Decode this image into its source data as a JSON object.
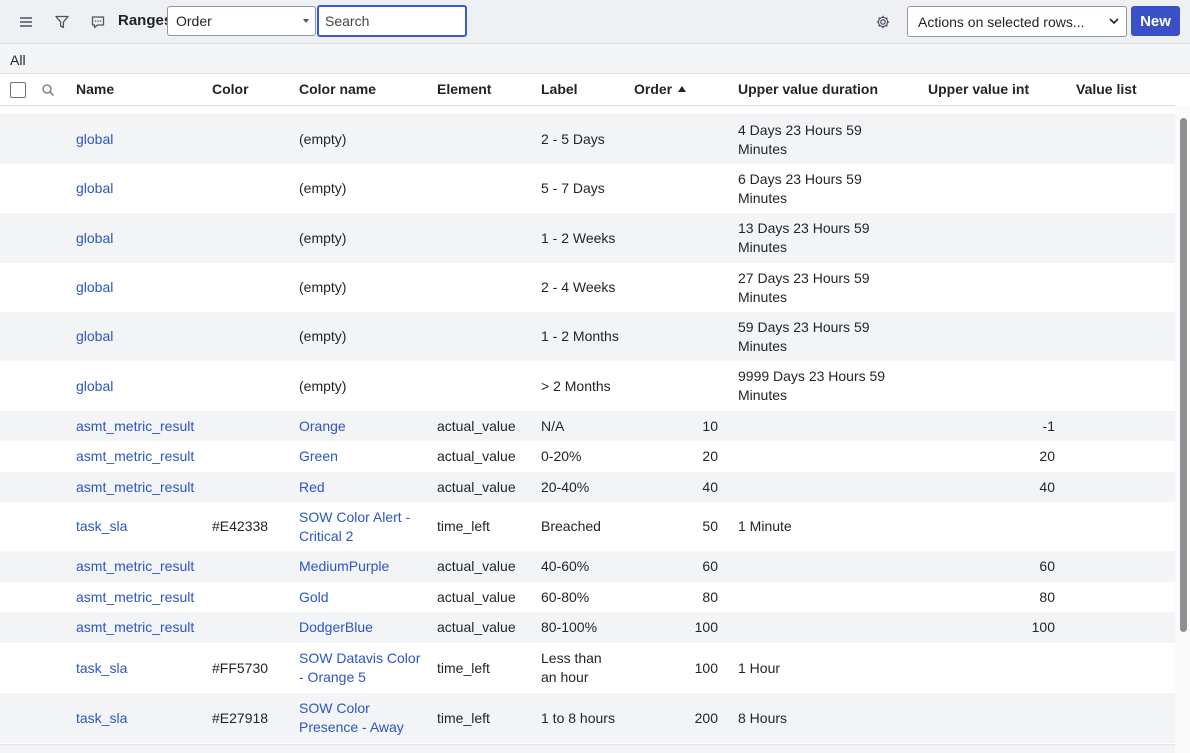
{
  "toolbar": {
    "list_title": "Ranges",
    "field_select": "Order",
    "search_placeholder": "Search",
    "actions_select": "Actions on selected rows...",
    "new_label": "New"
  },
  "breadcrumb": "All",
  "columns": {
    "name": "Name",
    "color": "Color",
    "color_name": "Color name",
    "element": "Element",
    "label": "Label",
    "order": "Order",
    "upper_duration": "Upper value duration",
    "upper_int": "Upper value int",
    "value_list": "Value list"
  },
  "rows": [
    {
      "name": "global",
      "color": "",
      "color_name": "(empty)",
      "element": "",
      "label": "2 - 5 Days",
      "order": "",
      "upper_duration": "4 Days 23 Hours 59 Minutes",
      "upper_int": "",
      "value_list": ""
    },
    {
      "name": "global",
      "color": "",
      "color_name": "(empty)",
      "element": "",
      "label": "5 - 7 Days",
      "order": "",
      "upper_duration": "6 Days 23 Hours 59 Minutes",
      "upper_int": "",
      "value_list": ""
    },
    {
      "name": "global",
      "color": "",
      "color_name": "(empty)",
      "element": "",
      "label": "1 - 2 Weeks",
      "order": "",
      "upper_duration": "13 Days 23 Hours 59 Minutes",
      "upper_int": "",
      "value_list": ""
    },
    {
      "name": "global",
      "color": "",
      "color_name": "(empty)",
      "element": "",
      "label": "2 - 4 Weeks",
      "order": "",
      "upper_duration": "27 Days 23 Hours 59 Minutes",
      "upper_int": "",
      "value_list": ""
    },
    {
      "name": "global",
      "color": "",
      "color_name": "(empty)",
      "element": "",
      "label": "1 - 2 Months",
      "order": "",
      "upper_duration": "59 Days 23 Hours 59 Minutes",
      "upper_int": "",
      "value_list": ""
    },
    {
      "name": "global",
      "color": "",
      "color_name": "(empty)",
      "element": "",
      "label": "> 2 Months",
      "order": "",
      "upper_duration": "9999 Days 23 Hours 59 Minutes",
      "upper_int": "",
      "value_list": ""
    },
    {
      "name": "asmt_metric_result",
      "color": "",
      "color_name": "Orange",
      "element": "actual_value",
      "label": "N/A",
      "order": "10",
      "upper_duration": "",
      "upper_int": "-1",
      "value_list": ""
    },
    {
      "name": "asmt_metric_result",
      "color": "",
      "color_name": "Green",
      "element": "actual_value",
      "label": "0-20%",
      "order": "20",
      "upper_duration": "",
      "upper_int": "20",
      "value_list": ""
    },
    {
      "name": "asmt_metric_result",
      "color": "",
      "color_name": "Red",
      "element": "actual_value",
      "label": "20-40%",
      "order": "40",
      "upper_duration": "",
      "upper_int": "40",
      "value_list": ""
    },
    {
      "name": "task_sla",
      "color": "#E42338",
      "color_name": "SOW Color Alert - Critical 2",
      "element": "time_left",
      "label": "Breached",
      "order": "50",
      "upper_duration": "1 Minute",
      "upper_int": "",
      "value_list": ""
    },
    {
      "name": "asmt_metric_result",
      "color": "",
      "color_name": "MediumPurple",
      "element": "actual_value",
      "label": "40-60%",
      "order": "60",
      "upper_duration": "",
      "upper_int": "60",
      "value_list": ""
    },
    {
      "name": "asmt_metric_result",
      "color": "",
      "color_name": "Gold",
      "element": "actual_value",
      "label": "60-80%",
      "order": "80",
      "upper_duration": "",
      "upper_int": "80",
      "value_list": ""
    },
    {
      "name": "asmt_metric_result",
      "color": "",
      "color_name": "DodgerBlue",
      "element": "actual_value",
      "label": "80-100%",
      "order": "100",
      "upper_duration": "",
      "upper_int": "100",
      "value_list": ""
    },
    {
      "name": "task_sla",
      "color": "#FF5730",
      "color_name": "SOW Datavis Color - Orange 5",
      "element": "time_left",
      "label": "Less than an hour",
      "order": "100",
      "upper_duration": "1 Hour",
      "upper_int": "",
      "value_list": ""
    },
    {
      "name": "task_sla",
      "color": "#E27918",
      "color_name": "SOW Color Presence - Away",
      "element": "time_left",
      "label": "1 to 8 hours",
      "order": "200",
      "upper_duration": "8 Hours",
      "upper_int": "",
      "value_list": ""
    }
  ],
  "colors": {
    "accent": "#3a50c9",
    "link": "#2b55c7",
    "row_alt": "#f3f4f6"
  }
}
